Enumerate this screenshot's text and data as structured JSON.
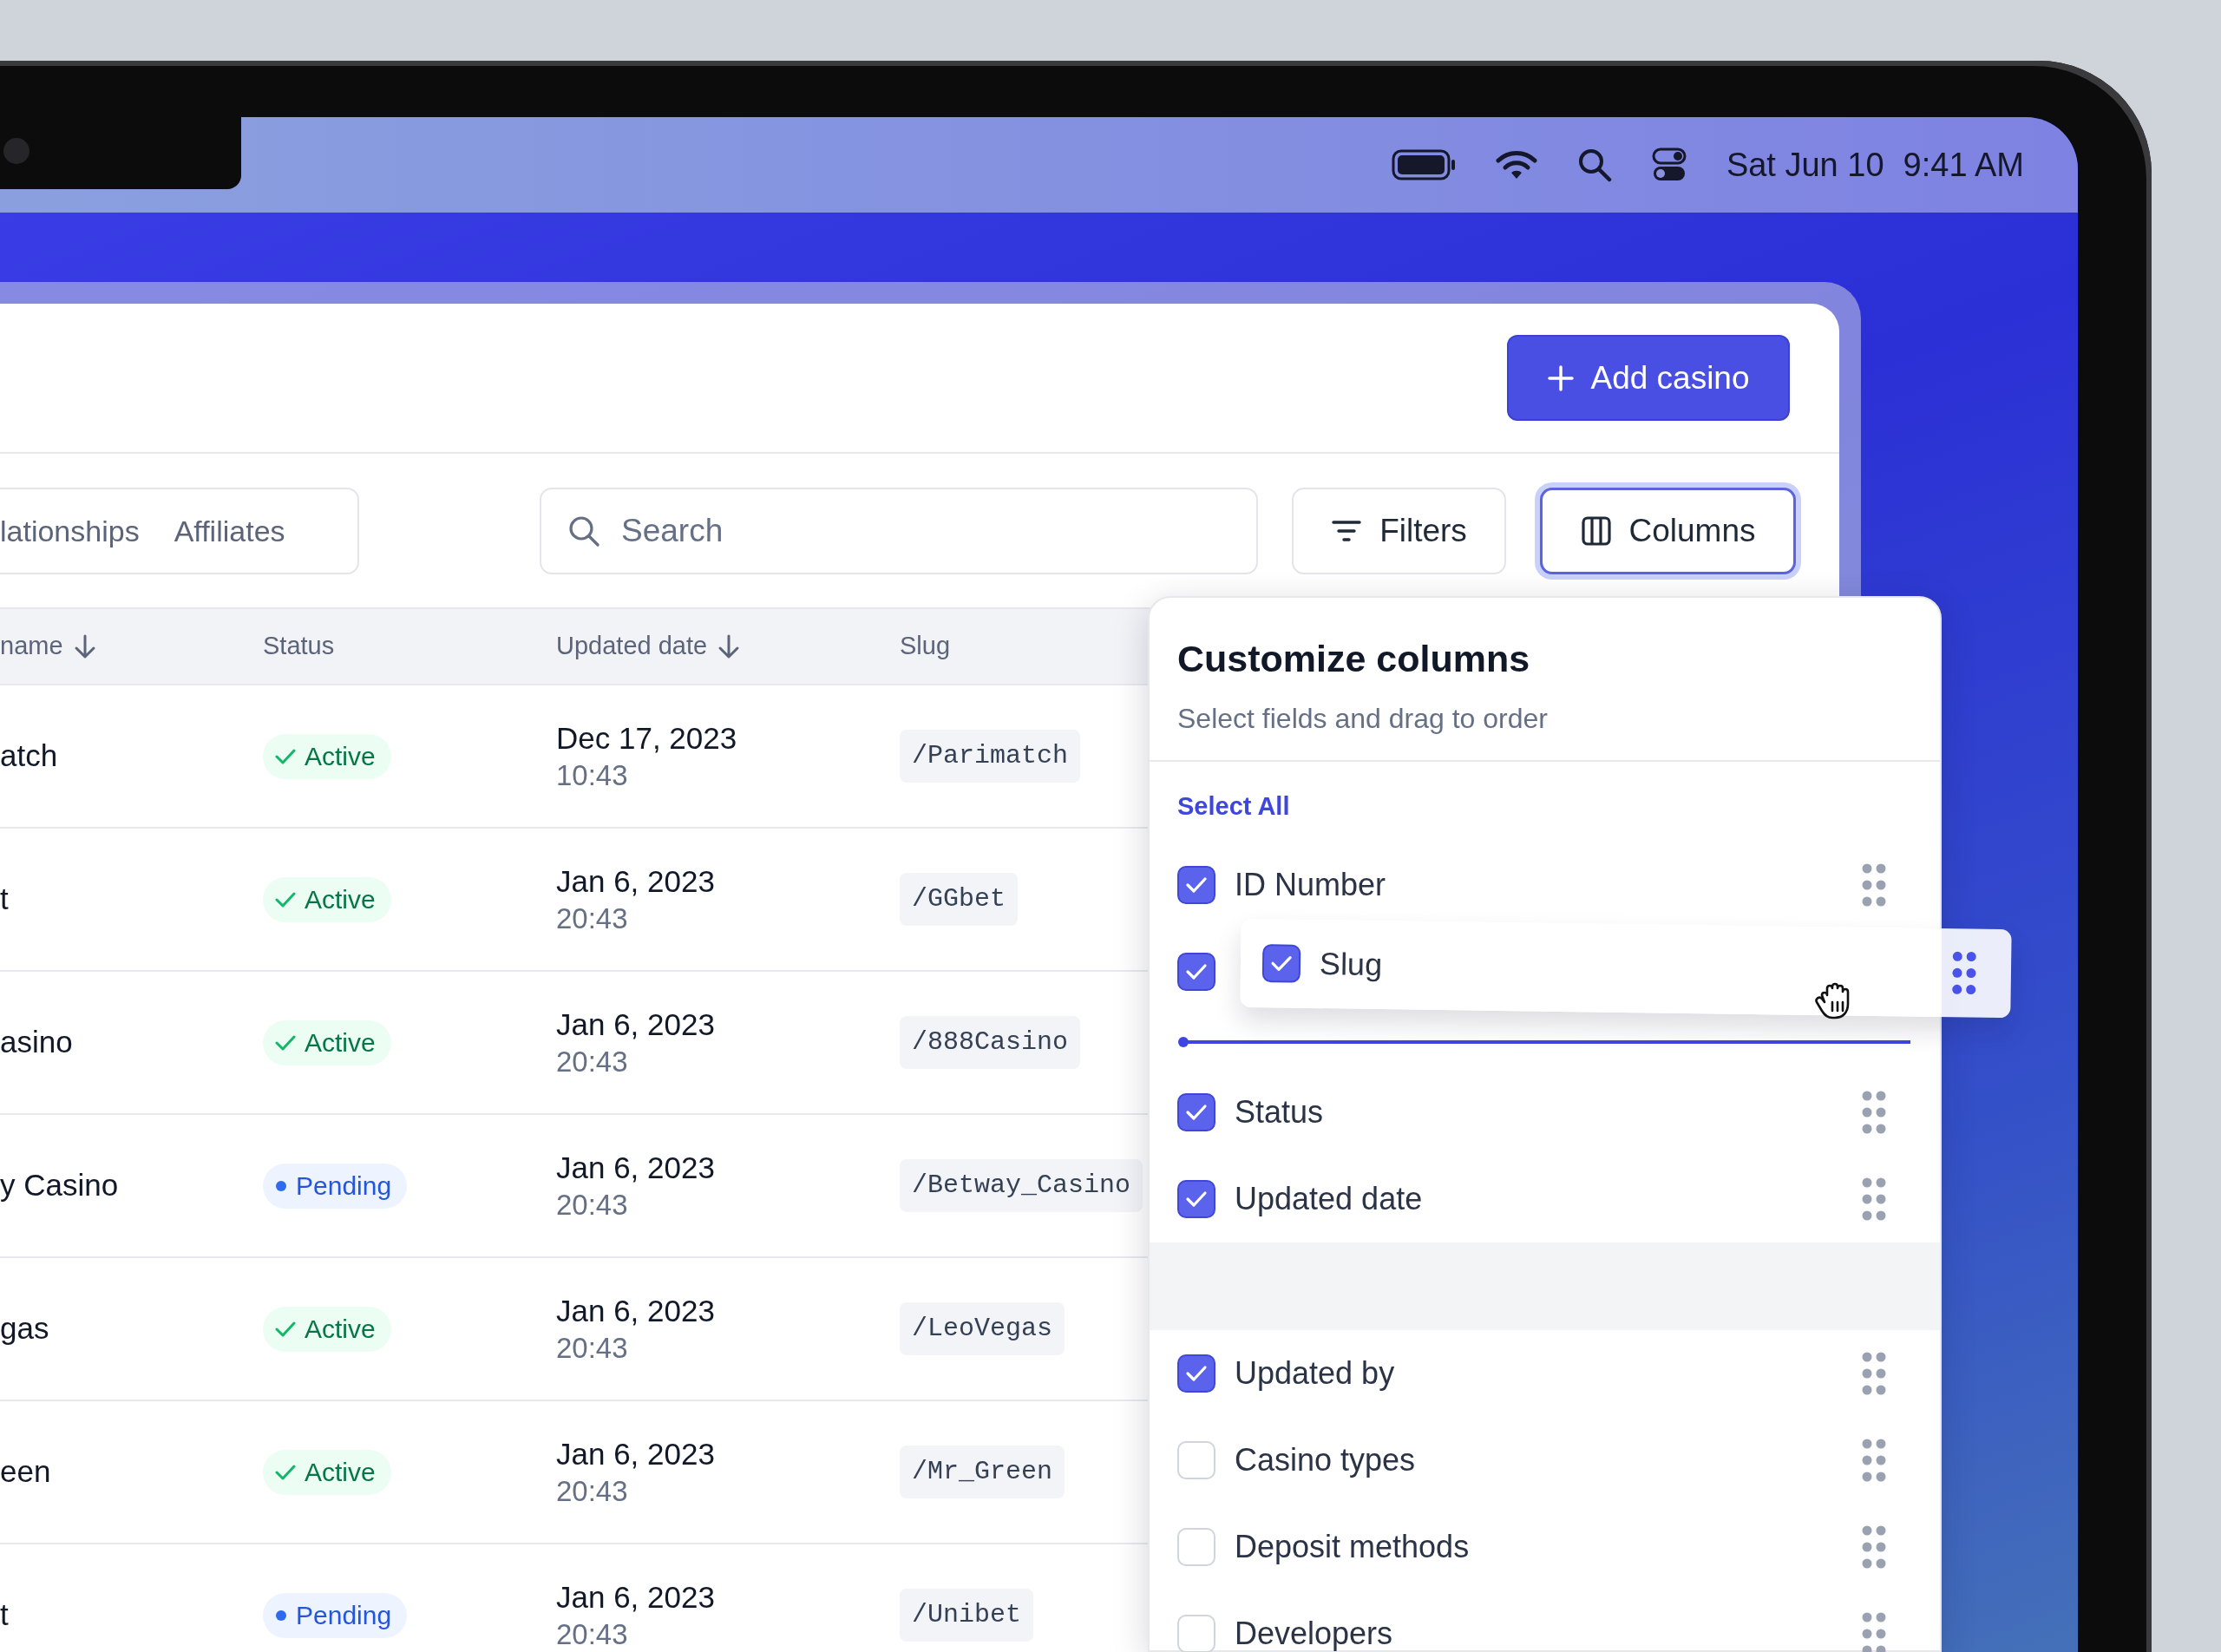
{
  "menu_bar": {
    "date": "Sat Jun 10",
    "time": "9:41 AM"
  },
  "header": {
    "add_button": "Add casino"
  },
  "tabs": [
    {
      "label": "lationships",
      "selected": false
    },
    {
      "label": "Affiliates",
      "selected": false
    }
  ],
  "search": {
    "placeholder": "Search"
  },
  "toolbar_buttons": [
    {
      "label": "Filters",
      "kind": "filters",
      "selected": false
    },
    {
      "label": "Columns",
      "kind": "columns",
      "selected": true
    }
  ],
  "table": {
    "columns": [
      {
        "label": "name",
        "sorted": true
      },
      {
        "label": "Status",
        "sorted": false
      },
      {
        "label": "Updated date",
        "sorted": true
      },
      {
        "label": "Slug",
        "sorted": false
      }
    ],
    "rows": [
      {
        "name": "atch",
        "status": {
          "kind": "active",
          "label": "Active"
        },
        "date": "Dec 17, 2023",
        "time": "10:43",
        "slug": "/Parimatch"
      },
      {
        "name": "t",
        "status": {
          "kind": "active",
          "label": "Active"
        },
        "date": "Jan 6, 2023",
        "time": "20:43",
        "slug": "/GGbet"
      },
      {
        "name": "asino",
        "status": {
          "kind": "active",
          "label": "Active"
        },
        "date": "Jan 6, 2023",
        "time": "20:43",
        "slug": "/888Casino"
      },
      {
        "name": "y Casino",
        "status": {
          "kind": "pending",
          "label": "Pending"
        },
        "date": "Jan 6, 2023",
        "time": "20:43",
        "slug": "/Betway_Casino"
      },
      {
        "name": "gas",
        "status": {
          "kind": "active",
          "label": "Active"
        },
        "date": "Jan 6, 2023",
        "time": "20:43",
        "slug": "/LeoVegas"
      },
      {
        "name": "een",
        "status": {
          "kind": "active",
          "label": "Active"
        },
        "date": "Jan 6, 2023",
        "time": "20:43",
        "slug": "/Mr_Green"
      },
      {
        "name": "t",
        "status": {
          "kind": "pending",
          "label": "Pending"
        },
        "date": "Jan 6, 2023",
        "time": "20:43",
        "slug": "/Unibet"
      }
    ]
  },
  "column_panel": {
    "title": "Customize columns",
    "subtitle": "Select fields and drag to order",
    "select_all": "Select All",
    "groups": [
      {
        "items": [
          {
            "kind": "item",
            "label": "ID Number",
            "checked": true
          },
          {
            "kind": "covered",
            "checked": true
          },
          {
            "kind": "drop_indicator"
          },
          {
            "kind": "item",
            "label": "Status",
            "checked": true
          },
          {
            "kind": "item",
            "label": "Updated date",
            "checked": true
          }
        ]
      },
      {
        "items": [
          {
            "kind": "item",
            "label": "Updated by",
            "checked": true
          },
          {
            "kind": "item",
            "label": "Casino types",
            "checked": false
          },
          {
            "kind": "item",
            "label": "Deposit methods",
            "checked": false
          },
          {
            "kind": "item",
            "label": "Developers",
            "checked": false
          }
        ]
      }
    ],
    "dragged_item": {
      "label": "Slug",
      "checked": true
    }
  }
}
